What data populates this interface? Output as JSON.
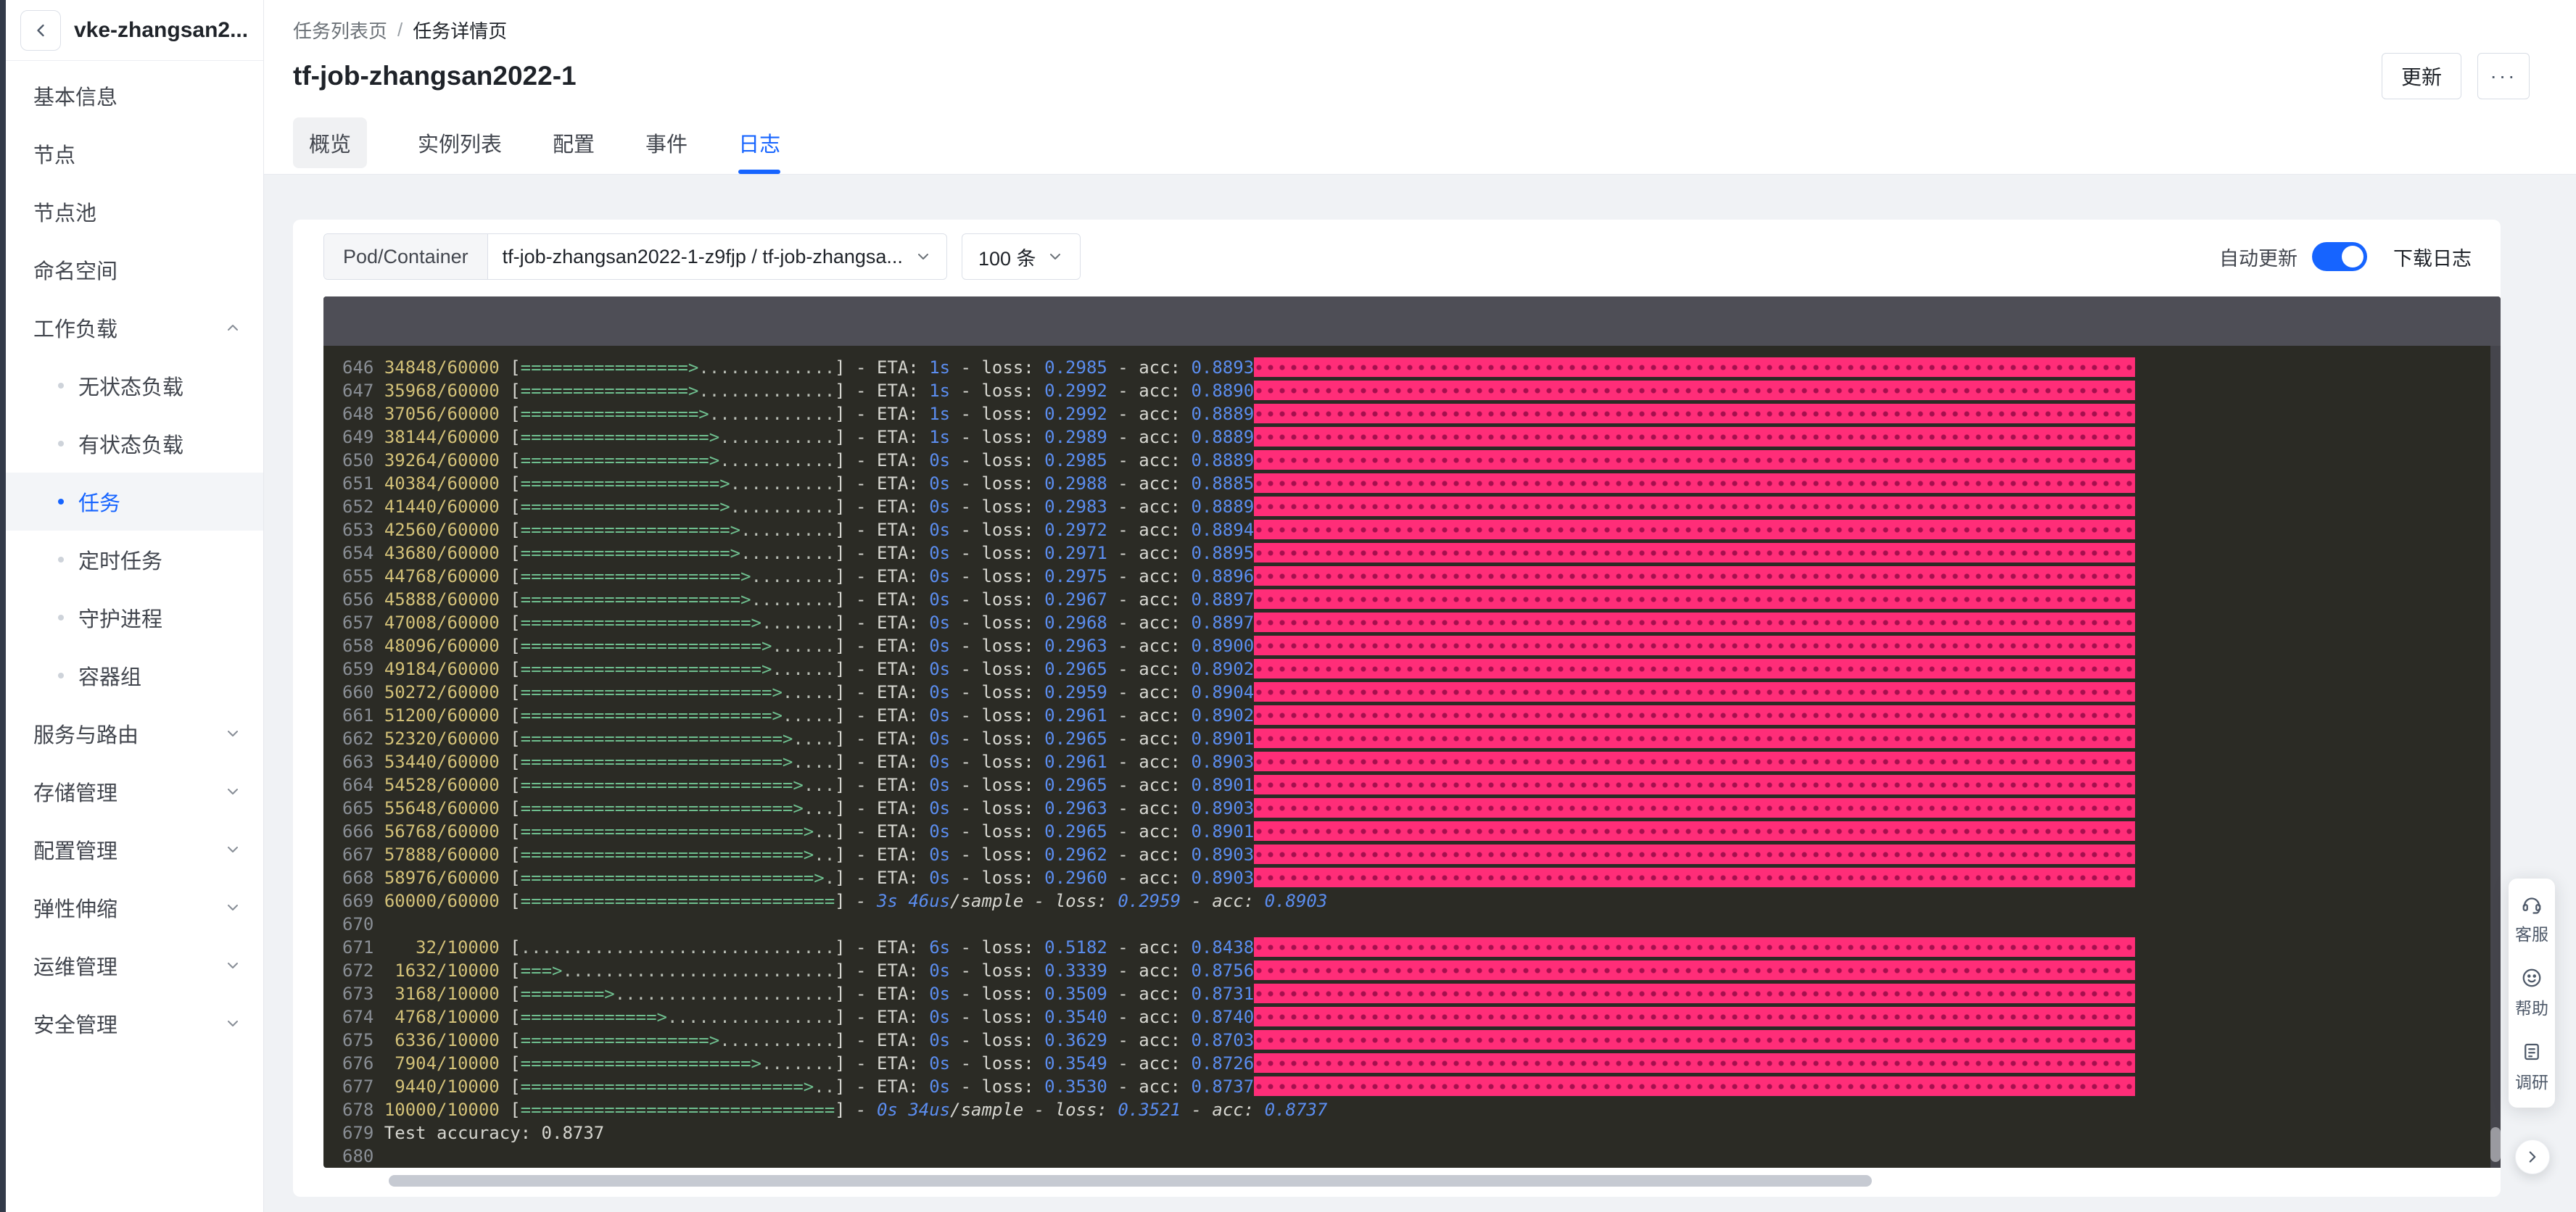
{
  "window": {
    "title": "vke-zhangsan2..."
  },
  "sidebar": {
    "items": [
      {
        "label": "基本信息",
        "type": "item"
      },
      {
        "label": "节点",
        "type": "item"
      },
      {
        "label": "节点池",
        "type": "item"
      },
      {
        "label": "命名空间",
        "type": "item"
      },
      {
        "label": "工作负载",
        "type": "group",
        "expanded": true
      },
      {
        "label": "无状态负载",
        "type": "child"
      },
      {
        "label": "有状态负载",
        "type": "child"
      },
      {
        "label": "任务",
        "type": "child",
        "active": true
      },
      {
        "label": "定时任务",
        "type": "child"
      },
      {
        "label": "守护进程",
        "type": "child"
      },
      {
        "label": "容器组",
        "type": "child"
      },
      {
        "label": "服务与路由",
        "type": "group"
      },
      {
        "label": "存储管理",
        "type": "group"
      },
      {
        "label": "配置管理",
        "type": "group"
      },
      {
        "label": "弹性伸缩",
        "type": "group"
      },
      {
        "label": "运维管理",
        "type": "group"
      },
      {
        "label": "安全管理",
        "type": "group"
      }
    ]
  },
  "breadcrumb": {
    "parent": "任务列表页",
    "separator": "/",
    "current": "任务详情页"
  },
  "page": {
    "title": "tf-job-zhangsan2022-1",
    "update_button": "更新",
    "more_button": "···"
  },
  "tabs": [
    {
      "label": "概览",
      "highlighted": true
    },
    {
      "label": "实例列表"
    },
    {
      "label": "配置"
    },
    {
      "label": "事件"
    },
    {
      "label": "日志",
      "active": true
    }
  ],
  "controls": {
    "pod_label": "Pod/Container",
    "pod_value": "tf-job-zhangsan2022-1-z9fjp / tf-job-zhangsa...",
    "count_value": "100 条",
    "auto_refresh": "自动更新",
    "auto_refresh_state": "on",
    "download": "下载日志"
  },
  "terminal": {
    "lines": [
      {
        "n": "646",
        "c": "34848/60000",
        "bar": "================>.............",
        "eta": "1s",
        "loss": "0.2985",
        "acc": "0.8893",
        "pink": true
      },
      {
        "n": "647",
        "c": "35968/60000",
        "bar": "================>.............",
        "eta": "1s",
        "loss": "0.2992",
        "acc": "0.8890",
        "pink": true
      },
      {
        "n": "648",
        "c": "37056/60000",
        "bar": "=================>............",
        "eta": "1s",
        "loss": "0.2992",
        "acc": "0.8889",
        "pink": true
      },
      {
        "n": "649",
        "c": "38144/60000",
        "bar": "==================>...........",
        "eta": "1s",
        "loss": "0.2989",
        "acc": "0.8889",
        "pink": true
      },
      {
        "n": "650",
        "c": "39264/60000",
        "bar": "==================>...........",
        "eta": "0s",
        "loss": "0.2985",
        "acc": "0.8889",
        "pink": true
      },
      {
        "n": "651",
        "c": "40384/60000",
        "bar": "===================>..........",
        "eta": "0s",
        "loss": "0.2988",
        "acc": "0.8885",
        "pink": true
      },
      {
        "n": "652",
        "c": "41440/60000",
        "bar": "===================>..........",
        "eta": "0s",
        "loss": "0.2983",
        "acc": "0.8889",
        "pink": true
      },
      {
        "n": "653",
        "c": "42560/60000",
        "bar": "====================>.........",
        "eta": "0s",
        "loss": "0.2972",
        "acc": "0.8894",
        "pink": true
      },
      {
        "n": "654",
        "c": "43680/60000",
        "bar": "====================>.........",
        "eta": "0s",
        "loss": "0.2971",
        "acc": "0.8895",
        "pink": true
      },
      {
        "n": "655",
        "c": "44768/60000",
        "bar": "=====================>........",
        "eta": "0s",
        "loss": "0.2975",
        "acc": "0.8896",
        "pink": true
      },
      {
        "n": "656",
        "c": "45888/60000",
        "bar": "=====================>........",
        "eta": "0s",
        "loss": "0.2967",
        "acc": "0.8897",
        "pink": true
      },
      {
        "n": "657",
        "c": "47008/60000",
        "bar": "======================>.......",
        "eta": "0s",
        "loss": "0.2968",
        "acc": "0.8897",
        "pink": true
      },
      {
        "n": "658",
        "c": "48096/60000",
        "bar": "=======================>......",
        "eta": "0s",
        "loss": "0.2963",
        "acc": "0.8900",
        "pink": true
      },
      {
        "n": "659",
        "c": "49184/60000",
        "bar": "=======================>......",
        "eta": "0s",
        "loss": "0.2965",
        "acc": "0.8902",
        "pink": true
      },
      {
        "n": "660",
        "c": "50272/60000",
        "bar": "========================>.....",
        "eta": "0s",
        "loss": "0.2959",
        "acc": "0.8904",
        "pink": true
      },
      {
        "n": "661",
        "c": "51200/60000",
        "bar": "========================>.....",
        "eta": "0s",
        "loss": "0.2961",
        "acc": "0.8902",
        "pink": true
      },
      {
        "n": "662",
        "c": "52320/60000",
        "bar": "=========================>....",
        "eta": "0s",
        "loss": "0.2965",
        "acc": "0.8901",
        "pink": true
      },
      {
        "n": "663",
        "c": "53440/60000",
        "bar": "=========================>....",
        "eta": "0s",
        "loss": "0.2961",
        "acc": "0.8903",
        "pink": true
      },
      {
        "n": "664",
        "c": "54528/60000",
        "bar": "==========================>...",
        "eta": "0s",
        "loss": "0.2965",
        "acc": "0.8901",
        "pink": true
      },
      {
        "n": "665",
        "c": "55648/60000",
        "bar": "==========================>...",
        "eta": "0s",
        "loss": "0.2963",
        "acc": "0.8903",
        "pink": true
      },
      {
        "n": "666",
        "c": "56768/60000",
        "bar": "===========================>..",
        "eta": "0s",
        "loss": "0.2965",
        "acc": "0.8901",
        "pink": true
      },
      {
        "n": "667",
        "c": "57888/60000",
        "bar": "===========================>..",
        "eta": "0s",
        "loss": "0.2962",
        "acc": "0.8903",
        "pink": true
      },
      {
        "n": "668",
        "c": "58976/60000",
        "bar": "============================>.",
        "eta": "0s",
        "loss": "0.2960",
        "acc": "0.8903",
        "pink": true
      },
      {
        "n": "669",
        "c": "60000/60000",
        "bar": "==============================",
        "time": "3s",
        "rate": "46us",
        "unit": "/sample",
        "loss": "0.2959",
        "acc": "0.8903",
        "italic": true
      },
      {
        "n": "670"
      },
      {
        "n": "671",
        "c": "   32/10000",
        "bar": "..............................",
        "eta": "6s",
        "loss": "0.5182",
        "acc": "0.8438",
        "pink": true
      },
      {
        "n": "672",
        "c": " 1632/10000",
        "bar": "===>..........................",
        "eta": "0s",
        "loss": "0.3339",
        "acc": "0.8756",
        "pink": true
      },
      {
        "n": "673",
        "c": " 3168/10000",
        "bar": "========>.....................",
        "eta": "0s",
        "loss": "0.3509",
        "acc": "0.8731",
        "pink": true
      },
      {
        "n": "674",
        "c": " 4768/10000",
        "bar": "=============>................",
        "eta": "0s",
        "loss": "0.3540",
        "acc": "0.8740",
        "pink": true
      },
      {
        "n": "675",
        "c": " 6336/10000",
        "bar": "==================>...........",
        "eta": "0s",
        "loss": "0.3629",
        "acc": "0.8703",
        "pink": true
      },
      {
        "n": "676",
        "c": " 7904/10000",
        "bar": "======================>.......",
        "eta": "0s",
        "loss": "0.3549",
        "acc": "0.8726",
        "pink": true
      },
      {
        "n": "677",
        "c": " 9440/10000",
        "bar": "===========================>..",
        "eta": "0s",
        "loss": "0.3530",
        "acc": "0.8737",
        "pink": true
      },
      {
        "n": "678",
        "c": "10000/10000",
        "bar": "==============================",
        "time": "0s",
        "rate": "34us",
        "unit": "/sample",
        "loss": "0.3521",
        "acc": "0.8737",
        "italic": true
      },
      {
        "n": "679",
        "text": "Test accuracy: 0.8737"
      },
      {
        "n": "680"
      }
    ]
  },
  "float_toolbar": {
    "items": [
      {
        "icon": "headset-icon",
        "label": "客服"
      },
      {
        "icon": "smiley-icon",
        "label": "帮助"
      },
      {
        "icon": "survey-icon",
        "label": "调研"
      }
    ]
  },
  "colors": {
    "accent": "#1664ff",
    "log_pink": "#ff2d78",
    "log_yellow": "#d3c178",
    "log_blue": "#5b8def",
    "log_green": "#6fbf8f",
    "terminal_bg": "#2b2b25"
  }
}
